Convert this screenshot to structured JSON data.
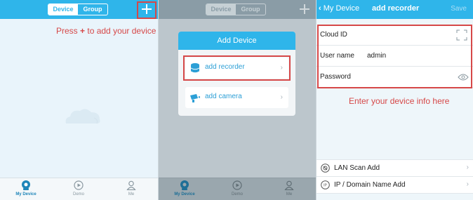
{
  "panel1": {
    "segment": {
      "left": "Device",
      "right": "Group"
    },
    "hint": {
      "pre": "Press ",
      "plus": "+",
      "post": " to add your device"
    },
    "tabs": [
      "My Device",
      "Demo",
      "Me"
    ]
  },
  "panel2": {
    "segment": {
      "left": "Device",
      "right": "Group"
    },
    "dialog": {
      "title": "Add Device",
      "options": [
        {
          "label": "add recorder",
          "icon": "database-icon"
        },
        {
          "label": "add camera",
          "icon": "camera-icon"
        }
      ]
    },
    "tabs": [
      "My Device",
      "Demo",
      "Me"
    ]
  },
  "panel3": {
    "back_label": "My Device",
    "title": "add recorder",
    "save_label": "Save",
    "fields": [
      {
        "label": "Cloud ID",
        "value": ""
      },
      {
        "label": "User name",
        "value": "admin"
      },
      {
        "label": "Password",
        "value": ""
      }
    ],
    "hint": "Enter your device info here",
    "list": [
      "LAN Scan Add",
      "IP / Domain Name Add"
    ]
  },
  "colors": {
    "accent": "#2fb5ea",
    "annotation": "#d64848",
    "active_tab": "#1f86b9"
  }
}
